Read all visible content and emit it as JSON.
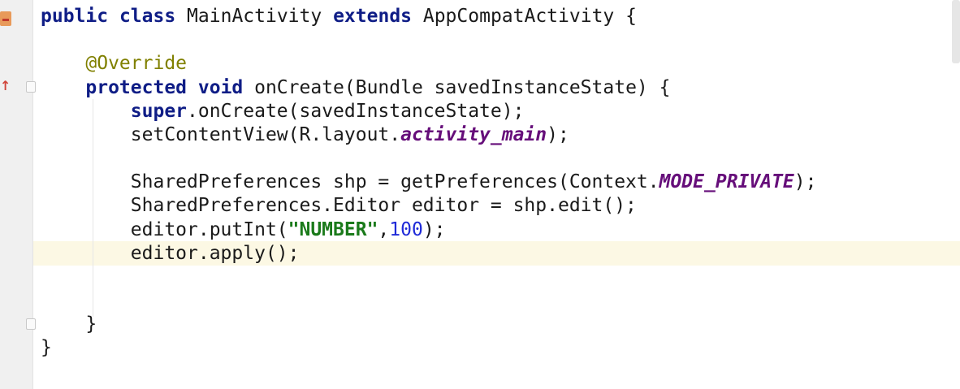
{
  "editor": {
    "language": "java",
    "current_line_index": 10,
    "gutter": {
      "icons": [
        "class-icon",
        "override-arrow-icon"
      ]
    },
    "lines": [
      {
        "tokens": [
          {
            "t": "kw",
            "v": "public"
          },
          {
            "t": "plain",
            "v": " "
          },
          {
            "t": "kw",
            "v": "class"
          },
          {
            "t": "plain",
            "v": " MainActivity "
          },
          {
            "t": "kw",
            "v": "extends"
          },
          {
            "t": "plain",
            "v": " AppCompatActivity {"
          }
        ]
      },
      {
        "tokens": []
      },
      {
        "tokens": [
          {
            "t": "plain",
            "v": "    "
          },
          {
            "t": "ann",
            "v": "@Override"
          }
        ]
      },
      {
        "tokens": [
          {
            "t": "plain",
            "v": "    "
          },
          {
            "t": "kw",
            "v": "protected"
          },
          {
            "t": "plain",
            "v": " "
          },
          {
            "t": "kw",
            "v": "void"
          },
          {
            "t": "plain",
            "v": " onCreate(Bundle savedInstanceState) {"
          }
        ]
      },
      {
        "tokens": [
          {
            "t": "plain",
            "v": "        "
          },
          {
            "t": "kw",
            "v": "super"
          },
          {
            "t": "plain",
            "v": ".onCreate(savedInstanceState);"
          }
        ]
      },
      {
        "tokens": [
          {
            "t": "plain",
            "v": "        setContentView(R.layout."
          },
          {
            "t": "fld",
            "v": "activity_main"
          },
          {
            "t": "plain",
            "v": ");"
          }
        ]
      },
      {
        "tokens": []
      },
      {
        "tokens": [
          {
            "t": "plain",
            "v": "        SharedPreferences shp = getPreferences(Context."
          },
          {
            "t": "fld",
            "v": "MODE_PRIVATE"
          },
          {
            "t": "plain",
            "v": ");"
          }
        ]
      },
      {
        "tokens": [
          {
            "t": "plain",
            "v": "        SharedPreferences.Editor editor = shp.edit();"
          }
        ]
      },
      {
        "tokens": [
          {
            "t": "plain",
            "v": "        editor.putInt("
          },
          {
            "t": "str",
            "v": "\"NUMBER\""
          },
          {
            "t": "plain",
            "v": ","
          },
          {
            "t": "num",
            "v": "100"
          },
          {
            "t": "plain",
            "v": ");"
          }
        ]
      },
      {
        "tokens": [
          {
            "t": "plain",
            "v": "        editor.apply();"
          }
        ]
      },
      {
        "tokens": []
      },
      {
        "tokens": []
      },
      {
        "tokens": [
          {
            "t": "plain",
            "v": "    }"
          }
        ]
      },
      {
        "tokens": [
          {
            "t": "plain",
            "v": "}"
          }
        ]
      }
    ]
  },
  "colors": {
    "keyword": "#0f1d86",
    "annotation": "#808000",
    "field": "#660e7a",
    "string": "#1a7a1a",
    "number": "#1f2ad8",
    "current_line": "#fcf8e4"
  }
}
